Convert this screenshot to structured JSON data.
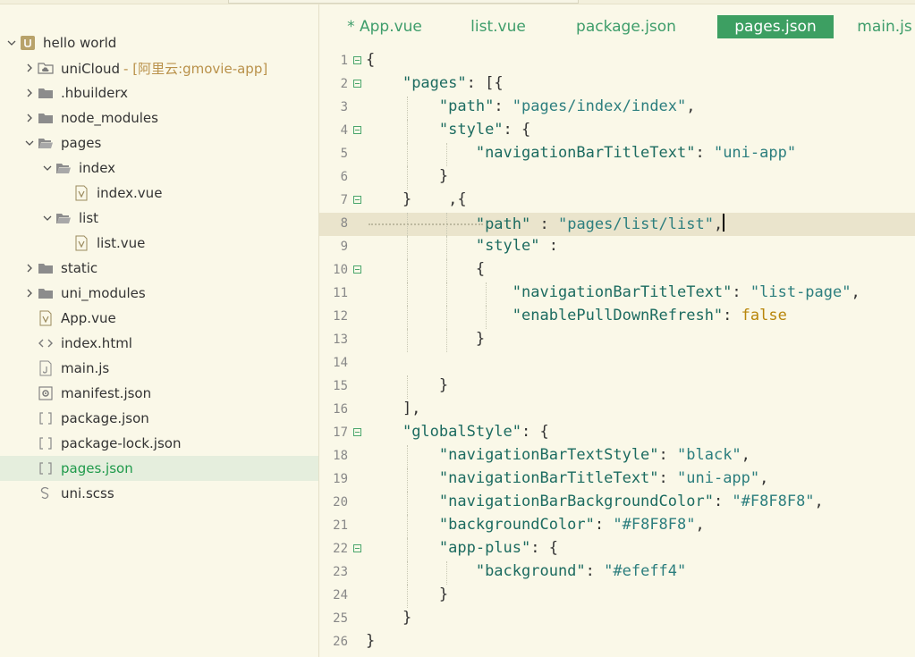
{
  "sidebar": {
    "items": [
      {
        "label": "hello world",
        "chevron": "down",
        "icon": "project-icon",
        "indent": 0
      },
      {
        "label": "uniCloud",
        "sublabel": "- [阿里云:gmovie-app]",
        "chevron": "right",
        "icon": "cloud-folder-icon",
        "indent": 1
      },
      {
        "label": ".hbuilderx",
        "chevron": "right",
        "icon": "folder-icon",
        "indent": 1
      },
      {
        "label": "node_modules",
        "chevron": "right",
        "icon": "folder-icon",
        "indent": 1
      },
      {
        "label": "pages",
        "chevron": "down",
        "icon": "folder-open-icon",
        "indent": 1
      },
      {
        "label": "index",
        "chevron": "down",
        "icon": "folder-open-icon",
        "indent": 2
      },
      {
        "label": "index.vue",
        "chevron": "",
        "icon": "vue-file-icon",
        "indent": 3
      },
      {
        "label": "list",
        "chevron": "down",
        "icon": "folder-open-icon",
        "indent": 2
      },
      {
        "label": "list.vue",
        "chevron": "",
        "icon": "vue-file-icon",
        "indent": 3
      },
      {
        "label": "static",
        "chevron": "right",
        "icon": "folder-icon",
        "indent": 1
      },
      {
        "label": "uni_modules",
        "chevron": "right",
        "icon": "folder-icon",
        "indent": 1
      },
      {
        "label": "App.vue",
        "chevron": "",
        "icon": "vue-file-icon",
        "indent": 1
      },
      {
        "label": "index.html",
        "chevron": "",
        "icon": "html-file-icon",
        "indent": 1
      },
      {
        "label": "main.js",
        "chevron": "",
        "icon": "js-file-icon",
        "indent": 1
      },
      {
        "label": "manifest.json",
        "chevron": "",
        "icon": "manifest-file-icon",
        "indent": 1
      },
      {
        "label": "package.json",
        "chevron": "",
        "icon": "json-file-icon",
        "indent": 1
      },
      {
        "label": "package-lock.json",
        "chevron": "",
        "icon": "json-file-icon",
        "indent": 1
      },
      {
        "label": "pages.json",
        "chevron": "",
        "icon": "json-file-icon",
        "indent": 1,
        "selected": true
      },
      {
        "label": "uni.scss",
        "chevron": "",
        "icon": "scss-file-icon",
        "indent": 1
      }
    ]
  },
  "tabs": [
    {
      "label": "* App.vue",
      "active": false
    },
    {
      "label": "list.vue",
      "active": false
    },
    {
      "label": "package.json",
      "active": false
    },
    {
      "label": "pages.json",
      "active": true
    },
    {
      "label": "main.js",
      "active": false
    }
  ],
  "editor": {
    "lines": [
      {
        "n": "1",
        "fold": true,
        "code": "{"
      },
      {
        "n": "2",
        "fold": true,
        "code": "    \"pages\": [{"
      },
      {
        "n": "3",
        "fold": false,
        "code": "        \"path\": \"pages/index/index\","
      },
      {
        "n": "4",
        "fold": true,
        "code": "        \"style\": {"
      },
      {
        "n": "5",
        "fold": false,
        "code": "            \"navigationBarTitleText\": \"uni-app\""
      },
      {
        "n": "6",
        "fold": false,
        "code": "        }"
      },
      {
        "n": "7",
        "fold": true,
        "code": "    }    ,{"
      },
      {
        "n": "8",
        "fold": false,
        "code": "            \"path\" : \"pages/list/list\",",
        "current": true
      },
      {
        "n": "9",
        "fold": false,
        "code": "            \"style\" :"
      },
      {
        "n": "10",
        "fold": true,
        "code": "            {"
      },
      {
        "n": "11",
        "fold": false,
        "code": "                \"navigationBarTitleText\": \"list-page\","
      },
      {
        "n": "12",
        "fold": false,
        "code": "                \"enablePullDownRefresh\": false"
      },
      {
        "n": "13",
        "fold": false,
        "code": "            }"
      },
      {
        "n": "14",
        "fold": false,
        "code": ""
      },
      {
        "n": "15",
        "fold": false,
        "code": "        }"
      },
      {
        "n": "16",
        "fold": false,
        "code": "    ],"
      },
      {
        "n": "17",
        "fold": true,
        "code": "    \"globalStyle\": {"
      },
      {
        "n": "18",
        "fold": false,
        "code": "        \"navigationBarTextStyle\": \"black\","
      },
      {
        "n": "19",
        "fold": false,
        "code": "        \"navigationBarTitleText\": \"uni-app\","
      },
      {
        "n": "20",
        "fold": false,
        "code": "        \"navigationBarBackgroundColor\": \"#F8F8F8\","
      },
      {
        "n": "21",
        "fold": false,
        "code": "        \"backgroundColor\": \"#F8F8F8\","
      },
      {
        "n": "22",
        "fold": true,
        "code": "        \"app-plus\": {"
      },
      {
        "n": "23",
        "fold": false,
        "code": "            \"background\": \"#efeff4\""
      },
      {
        "n": "24",
        "fold": false,
        "code": "        }"
      },
      {
        "n": "25",
        "fold": false,
        "code": "    }"
      },
      {
        "n": "26",
        "fold": false,
        "code": "}"
      }
    ]
  },
  "colors": {
    "accent": "#3D9F62",
    "key": "#1C6B60",
    "string": "#2C7E7E",
    "boolean": "#B8860B",
    "background": "#FAF8E8"
  }
}
